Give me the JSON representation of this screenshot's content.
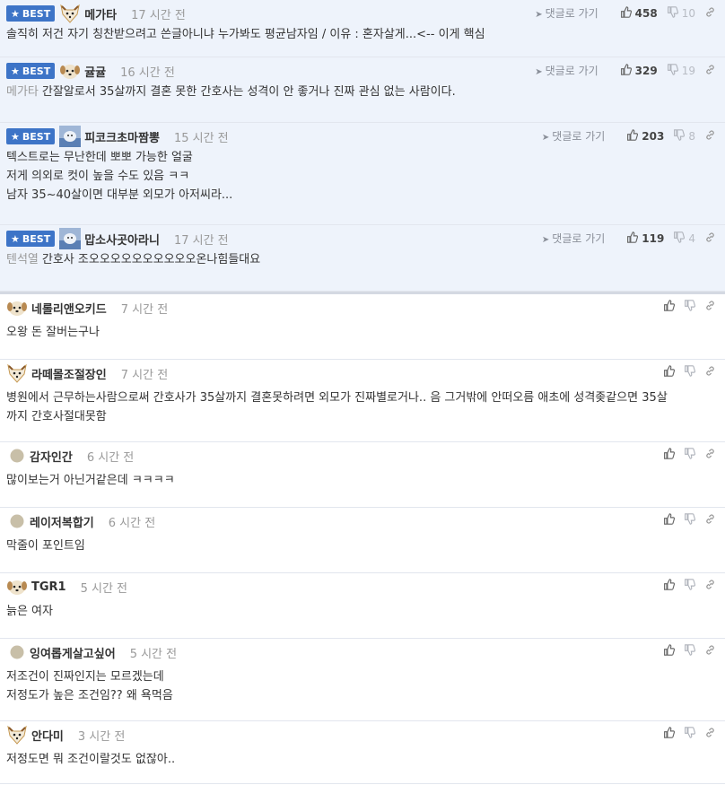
{
  "ui": {
    "best_label": "BEST",
    "goto_label": "댓글로 가기"
  },
  "best_comments": [
    {
      "nick": "메가타",
      "time": "17 시간 전",
      "up": "458",
      "down": "10",
      "reply_to": "",
      "lines": [
        "솔직히 저건 자기 칭찬받으려고 쓴글아니냐 누가봐도 평균남자임 / 이유 : 혼자살게...<-- 이게 핵심"
      ],
      "avatar": "fox-avatar"
    },
    {
      "nick": "귤귤",
      "time": "16 시간 전",
      "up": "329",
      "down": "19",
      "reply_to": "메가타",
      "lines": [
        "간잘알로서 35살까지 결혼 못한 간호사는 성격이 안 좋거나 진짜 관심 없는 사람이다."
      ],
      "avatar": "dog-avatar"
    },
    {
      "nick": "피코크초마짬뽕",
      "time": "15 시간 전",
      "up": "203",
      "down": "8",
      "reply_to": "",
      "lines": [
        "텍스트로는 무난한데 뽀뽀 가능한 얼굴",
        "저게 의외로 컷이 높을 수도 있음 ㅋㅋ",
        "남자 35~40살이면 대부분 외모가 아저씨라..."
      ],
      "avatar": "photo-avatar"
    },
    {
      "nick": "맙소사곳아라니",
      "time": "17 시간 전",
      "up": "119",
      "down": "4",
      "reply_to": "텐석열",
      "lines": [
        "간호사 조오오오오오오오오오오온나힘들대요"
      ],
      "avatar": "photo-avatar"
    }
  ],
  "comments": [
    {
      "nick": "네롤리앤오키드",
      "time": "7 시간 전",
      "lines": [
        "오왕 돈 잘버는구나"
      ],
      "avatar": "dog-avatar"
    },
    {
      "nick": "라떼몰조절장인",
      "time": "7 시간 전",
      "lines": [
        "병원에서 근무하는사람으로써 간호사가 35살까지 결혼못하려면 외모가 진짜별로거나.. 음 그거밖에 안떠오름 애초에 성격좆같으면 35살",
        "까지 간호사절대못함"
      ],
      "avatar": "fox-avatar"
    },
    {
      "nick": "감자인간",
      "time": "6 시간 전",
      "lines": [
        "많이보는거 아닌거같은데 ㅋㅋㅋㅋ"
      ],
      "avatar": "default-avatar"
    },
    {
      "nick": "레이저복합기",
      "time": "6 시간 전",
      "lines": [
        "막줄이 포인트임"
      ],
      "avatar": "default-avatar"
    },
    {
      "nick": "TGR1",
      "time": "5 시간 전",
      "lines": [
        "늙은 여자"
      ],
      "avatar": "dog-avatar"
    },
    {
      "nick": "잉여롭게살고싶어",
      "time": "5 시간 전",
      "lines": [
        "저조건이 진짜인지는 모르겠는데",
        "저정도가 높은 조건임?? 왜 욕먹음"
      ],
      "avatar": "default-avatar"
    },
    {
      "nick": "안다미",
      "time": "3 시간 전",
      "lines": [
        "저정도면 뭐 조건이랄것도 없잖아.."
      ],
      "avatar": "fox-avatar"
    }
  ]
}
